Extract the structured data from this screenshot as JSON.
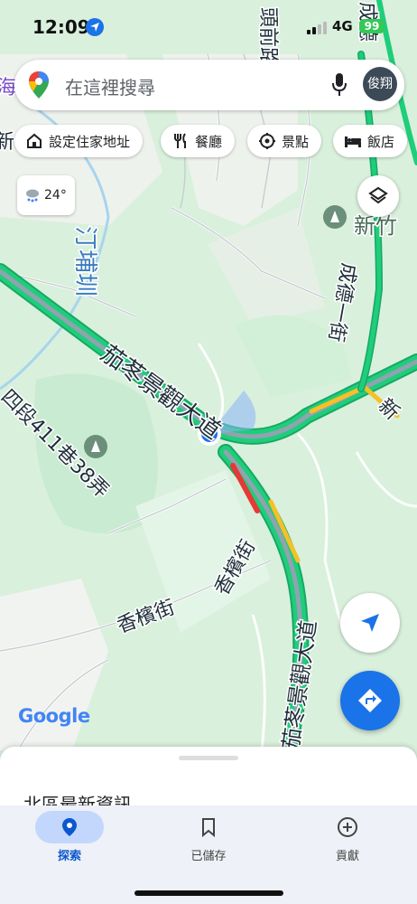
{
  "status_bar": {
    "time": "12:09",
    "network": "4G",
    "battery": "99"
  },
  "search": {
    "placeholder": "在這裡搜尋",
    "avatar_text": "俊翔"
  },
  "chips": [
    {
      "label": "設定住家地址",
      "icon": "home-icon"
    },
    {
      "label": "餐廳",
      "icon": "restaurant-icon"
    },
    {
      "label": "景點",
      "icon": "attraction-icon"
    },
    {
      "label": "飯店",
      "icon": "hotel-icon"
    }
  ],
  "weather": {
    "temperature": "24°",
    "icon": "rain-cloud-icon"
  },
  "map": {
    "streets": {
      "top_road": "頭前路",
      "chengde": "成德一街",
      "jiadong": "茄苳景觀大道",
      "jiadong_right": "茄苳景觀大道",
      "xinbing_1": "香檳街",
      "xinbing_2": "香檳街",
      "lane": "四段411巷38弄",
      "canal": "汀埔圳",
      "xin_right": "新",
      "xinzhu": "新竹",
      "top_right": "成德",
      "left_edge_1": "海",
      "left_edge_2": "新"
    },
    "brand": "Google",
    "colors": {
      "road_green": "#1dbf73",
      "road_red": "#e53935",
      "road_yellow": "#f6c026",
      "park": "#c8ecd0",
      "location": "#1a73e8"
    }
  },
  "sheet": {
    "title": "北區最新資訊"
  },
  "nav": [
    {
      "label": "探索",
      "icon": "explore-pin-icon",
      "active": true
    },
    {
      "label": "已儲存",
      "icon": "bookmark-icon",
      "active": false
    },
    {
      "label": "貢獻",
      "icon": "add-circle-icon",
      "active": false
    }
  ]
}
